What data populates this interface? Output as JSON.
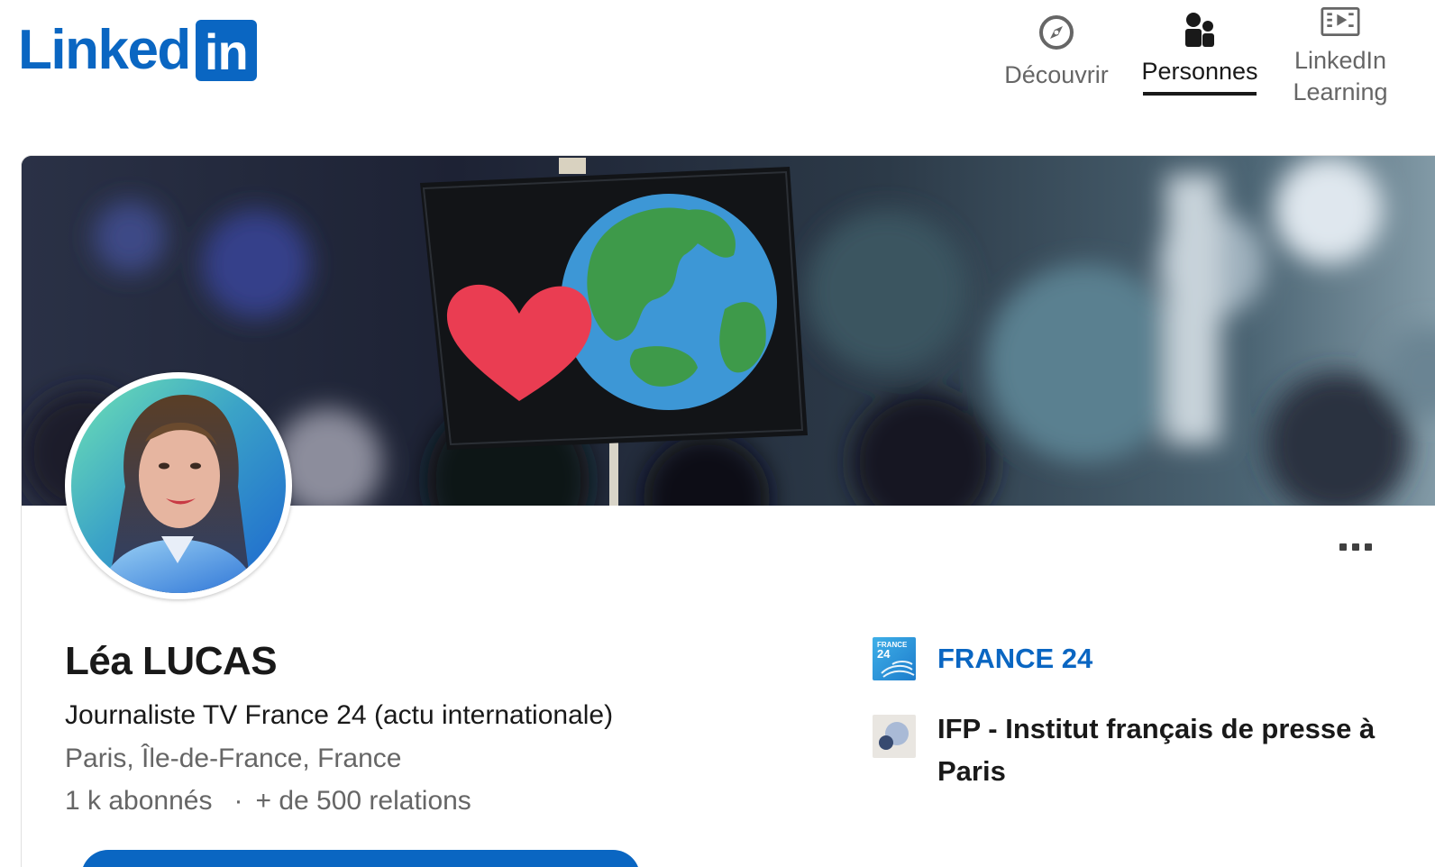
{
  "header": {
    "logo_text": "Linked",
    "logo_box_text": "in",
    "nav": [
      {
        "label": "Découvrir",
        "icon": "compass-icon",
        "active": false
      },
      {
        "label": "Personnes",
        "icon": "people-icon",
        "active": true
      },
      {
        "label": "LinkedIn Learning",
        "icon": "learning-video-icon",
        "active": false
      }
    ]
  },
  "profile": {
    "name": "Léa LUCAS",
    "headline": "Journaliste TV France 24 (actu internationale)",
    "location": "Paris, Île-de-France, France",
    "followers": "1 k abonnés",
    "separator": "·",
    "connections": "+ de 500 relations"
  },
  "organizations": [
    {
      "name": "FRANCE 24",
      "logo_text_top": "FRANCE",
      "logo_text_bottom": "24",
      "link": true
    },
    {
      "name": "IFP - Institut français de presse à Paris",
      "link": false
    }
  ],
  "colors": {
    "brand": "#0a66c2",
    "text_primary": "#191919",
    "text_secondary": "#666666"
  }
}
